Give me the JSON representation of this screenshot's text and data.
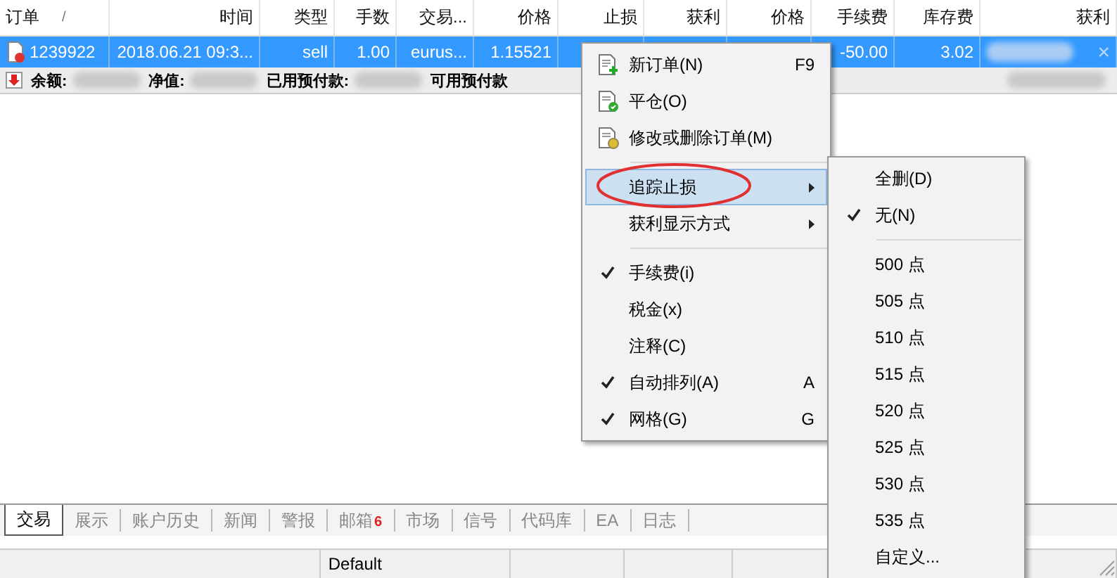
{
  "table": {
    "columns": [
      {
        "label": "订单",
        "sort_mark": "/"
      },
      {
        "label": "时间"
      },
      {
        "label": "类型"
      },
      {
        "label": "手数"
      },
      {
        "label": "交易..."
      },
      {
        "label": "价格"
      },
      {
        "label": "止损"
      },
      {
        "label": "获利"
      },
      {
        "label": "价格"
      },
      {
        "label": "手续费"
      },
      {
        "label": "库存费"
      },
      {
        "label": "获利"
      }
    ],
    "rows": [
      {
        "selected": true,
        "close_mark": "×",
        "cells": [
          {
            "kind": "text",
            "text": "1239922"
          },
          {
            "kind": "text",
            "text": "2018.06.21 09:3..."
          },
          {
            "kind": "text",
            "text": "sell"
          },
          {
            "kind": "text",
            "text": "1.00"
          },
          {
            "kind": "text",
            "text": "eurus..."
          },
          {
            "kind": "text",
            "text": "1.15521"
          },
          {
            "kind": "hidden"
          },
          {
            "kind": "hidden"
          },
          {
            "kind": "hidden"
          },
          {
            "kind": "text",
            "text": "-50.00"
          },
          {
            "kind": "text",
            "text": "3.02"
          },
          {
            "kind": "blurred"
          }
        ]
      }
    ],
    "summary": [
      {
        "label": "余额:"
      },
      {
        "label": "净值:"
      },
      {
        "label": "已用预付款:"
      },
      {
        "label": "可用预付款"
      }
    ]
  },
  "context_menu": {
    "items": [
      {
        "kind": "item",
        "label": "新订单(N)",
        "shortcut": "F9"
      },
      {
        "kind": "item",
        "label": "平仓(O)"
      },
      {
        "kind": "item",
        "label": "修改或删除订单(M)"
      },
      {
        "kind": "separator"
      },
      {
        "kind": "submenu",
        "label": "追踪止损",
        "selected": true,
        "circled": true
      },
      {
        "kind": "submenu",
        "label": "获利显示方式",
        "selected": false,
        "circled": false
      },
      {
        "kind": "separator"
      },
      {
        "kind": "check",
        "label": "手续费(i)",
        "checked": true
      },
      {
        "kind": "check",
        "label": "税金(x)",
        "checked": false
      },
      {
        "kind": "check",
        "label": "注释(C)",
        "checked": false
      },
      {
        "kind": "check",
        "label": "自动排列(A)",
        "shortcut": "A",
        "checked": true
      },
      {
        "kind": "check",
        "label": "网格(G)",
        "shortcut": "G",
        "checked": true
      }
    ]
  },
  "submenu": {
    "items": [
      {
        "kind": "check",
        "label": "全删(D)",
        "checked": false
      },
      {
        "kind": "check",
        "label": "无(N)",
        "checked": true
      },
      {
        "kind": "separator"
      },
      {
        "kind": "check",
        "label": "500 点",
        "checked": false
      },
      {
        "kind": "check",
        "label": "505 点",
        "checked": false
      },
      {
        "kind": "check",
        "label": "510 点",
        "checked": false
      },
      {
        "kind": "check",
        "label": "515 点",
        "checked": false
      },
      {
        "kind": "check",
        "label": "520 点",
        "checked": false
      },
      {
        "kind": "check",
        "label": "525 点",
        "checked": false
      },
      {
        "kind": "check",
        "label": "530 点",
        "checked": false
      },
      {
        "kind": "check",
        "label": "535 点",
        "checked": false
      },
      {
        "kind": "check",
        "label": "自定义...",
        "checked": false
      }
    ]
  },
  "tabs": [
    {
      "label": "交易",
      "selected": true
    },
    {
      "label": "展示",
      "selected": false
    },
    {
      "label": "账户历史",
      "selected": false
    },
    {
      "label": "新闻",
      "selected": false
    },
    {
      "label": "警报",
      "selected": false
    },
    {
      "label": "邮箱",
      "selected": false,
      "badge": "6"
    },
    {
      "label": "市场",
      "selected": false
    },
    {
      "label": "信号",
      "selected": false
    },
    {
      "label": "代码库",
      "selected": false
    },
    {
      "label": "EA",
      "selected": false
    },
    {
      "label": "日志",
      "selected": false
    }
  ],
  "status_bar": {
    "cells": [
      {
        "kind": "empty"
      },
      {
        "kind": "text",
        "text": "Default"
      },
      {
        "kind": "empty"
      },
      {
        "kind": "empty"
      },
      {
        "kind": "empty"
      }
    ]
  }
}
